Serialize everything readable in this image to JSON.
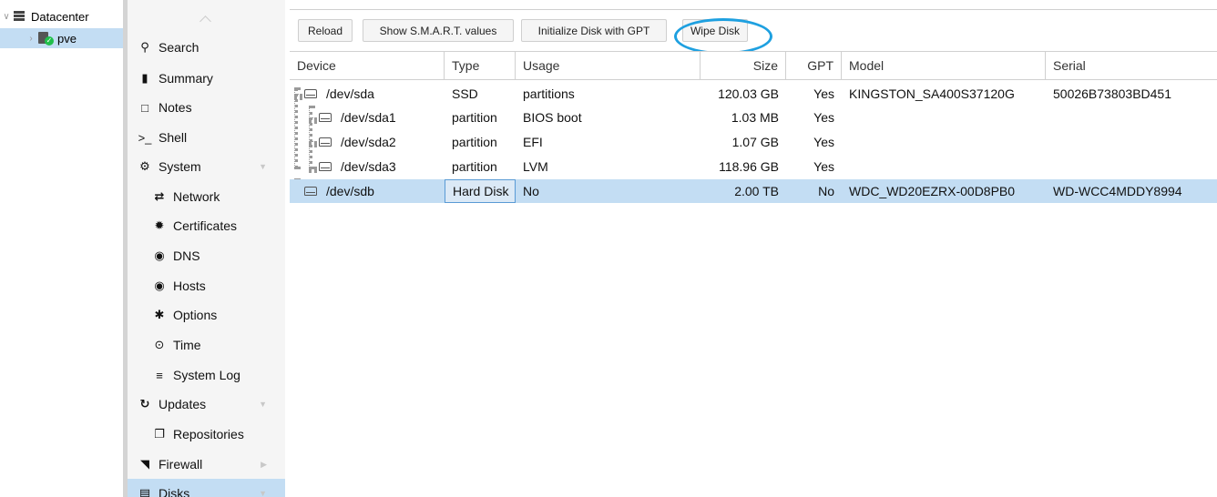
{
  "tree": {
    "datacenter_label": "Datacenter",
    "node_label": "pve"
  },
  "menu": {
    "items": [
      {
        "label": "Search",
        "icon": "search-icon"
      },
      {
        "label": "Summary",
        "icon": "book-icon"
      },
      {
        "label": "Notes",
        "icon": "note-icon"
      },
      {
        "label": "Shell",
        "icon": "terminal-icon"
      },
      {
        "label": "System",
        "icon": "gears-icon"
      },
      {
        "label": "Network",
        "icon": "exchange-icon"
      },
      {
        "label": "Certificates",
        "icon": "certificate-icon"
      },
      {
        "label": "DNS",
        "icon": "globe-icon"
      },
      {
        "label": "Hosts",
        "icon": "globe-icon"
      },
      {
        "label": "Options",
        "icon": "gear-icon"
      },
      {
        "label": "Time",
        "icon": "clock-icon"
      },
      {
        "label": "System Log",
        "icon": "list-icon"
      },
      {
        "label": "Updates",
        "icon": "refresh-icon"
      },
      {
        "label": "Repositories",
        "icon": "files-icon"
      },
      {
        "label": "Firewall",
        "icon": "shield-icon"
      },
      {
        "label": "Disks",
        "icon": "hdd-icon"
      }
    ]
  },
  "toolbar": {
    "reload": "Reload",
    "smart": "Show S.M.A.R.T. values",
    "gpt": "Initialize Disk with GPT",
    "wipe": "Wipe Disk"
  },
  "grid": {
    "columns": [
      "Device",
      "Type",
      "Usage",
      "Size",
      "GPT",
      "Model",
      "Serial"
    ],
    "rows": [
      {
        "device": "/dev/sda",
        "type": "SSD",
        "usage": "partitions",
        "size": "120.03 GB",
        "gpt": "Yes",
        "model": "KINGSTON_SA400S37120G",
        "serial": "50026B73803BD451"
      },
      {
        "device": "/dev/sda1",
        "type": "partition",
        "usage": "BIOS boot",
        "size": "1.03 MB",
        "gpt": "Yes",
        "model": "",
        "serial": ""
      },
      {
        "device": "/dev/sda2",
        "type": "partition",
        "usage": "EFI",
        "size": "1.07 GB",
        "gpt": "Yes",
        "model": "",
        "serial": ""
      },
      {
        "device": "/dev/sda3",
        "type": "partition",
        "usage": "LVM",
        "size": "118.96 GB",
        "gpt": "Yes",
        "model": "",
        "serial": ""
      },
      {
        "device": "/dev/sdb",
        "type": "Hard Disk",
        "usage": "No",
        "size": "2.00 TB",
        "gpt": "No",
        "model": "WDC_WD20EZRX-00D8PB0",
        "serial": "WD-WCC4MDDY8994"
      }
    ]
  },
  "colors": {
    "selection": "#c3ddf3",
    "highlight_ellipse": "#1ea0e0",
    "menu_bg": "#f5f5f5"
  }
}
